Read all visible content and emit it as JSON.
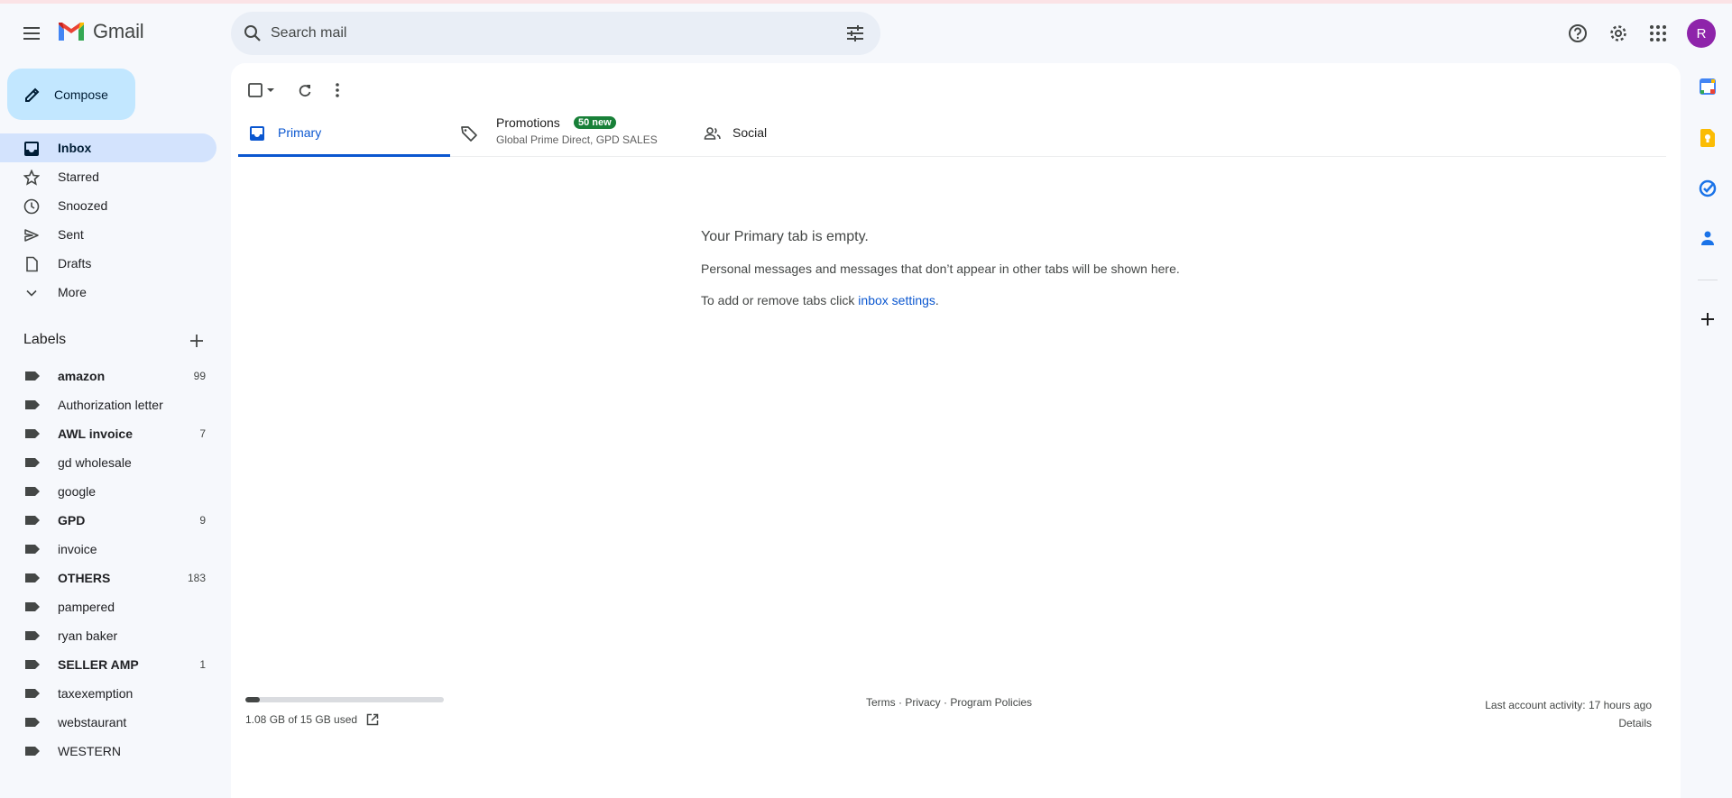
{
  "app": {
    "name": "Gmail"
  },
  "search": {
    "placeholder": "Search mail"
  },
  "header": {
    "avatar_initial": "R"
  },
  "compose": {
    "label": "Compose"
  },
  "nav": {
    "items": [
      {
        "label": "Inbox",
        "icon": "inbox-icon",
        "active": true
      },
      {
        "label": "Starred",
        "icon": "star-icon"
      },
      {
        "label": "Snoozed",
        "icon": "clock-icon"
      },
      {
        "label": "Sent",
        "icon": "send-icon"
      },
      {
        "label": "Drafts",
        "icon": "draft-icon"
      },
      {
        "label": "More",
        "icon": "chevron-down-icon"
      }
    ]
  },
  "labels": {
    "heading": "Labels",
    "items": [
      {
        "name": "amazon",
        "count": "99",
        "bold": true
      },
      {
        "name": "Authorization letter",
        "count": "",
        "bold": false
      },
      {
        "name": "AWL invoice",
        "count": "7",
        "bold": true
      },
      {
        "name": "gd wholesale",
        "count": "",
        "bold": false
      },
      {
        "name": "google",
        "count": "",
        "bold": false
      },
      {
        "name": "GPD",
        "count": "9",
        "bold": true
      },
      {
        "name": "invoice",
        "count": "",
        "bold": false
      },
      {
        "name": "OTHERS",
        "count": "183",
        "bold": true
      },
      {
        "name": "pampered",
        "count": "",
        "bold": false
      },
      {
        "name": "ryan baker",
        "count": "",
        "bold": false
      },
      {
        "name": "SELLER AMP",
        "count": "1",
        "bold": true
      },
      {
        "name": "taxexemption",
        "count": "",
        "bold": false
      },
      {
        "name": "webstaurant",
        "count": "",
        "bold": false
      },
      {
        "name": "WESTERN",
        "count": "",
        "bold": false
      }
    ]
  },
  "tabs": {
    "primary": {
      "label": "Primary"
    },
    "promotions": {
      "label": "Promotions",
      "badge": "50 new",
      "subtitle": "Global Prime Direct, GPD SALES"
    },
    "social": {
      "label": "Social"
    }
  },
  "empty_state": {
    "title": "Your Primary tab is empty.",
    "description": "Personal messages and messages that don’t appear in other tabs will be shown here.",
    "settings_prefix": "To add or remove tabs click ",
    "settings_link": "inbox settings",
    "settings_suffix": "."
  },
  "footer": {
    "storage_text": "1.08 GB of 15 GB used",
    "storage_fraction": 0.072,
    "links": "Terms · Privacy · Program Policies",
    "last_activity": "Last account activity: 17 hours ago",
    "details": "Details"
  },
  "colors": {
    "accent": "#0b57d0",
    "compose_bg": "#c2e7ff",
    "active_nav": "#d3e3fd",
    "badge_green": "#188038",
    "avatar": "#8e24aa"
  }
}
